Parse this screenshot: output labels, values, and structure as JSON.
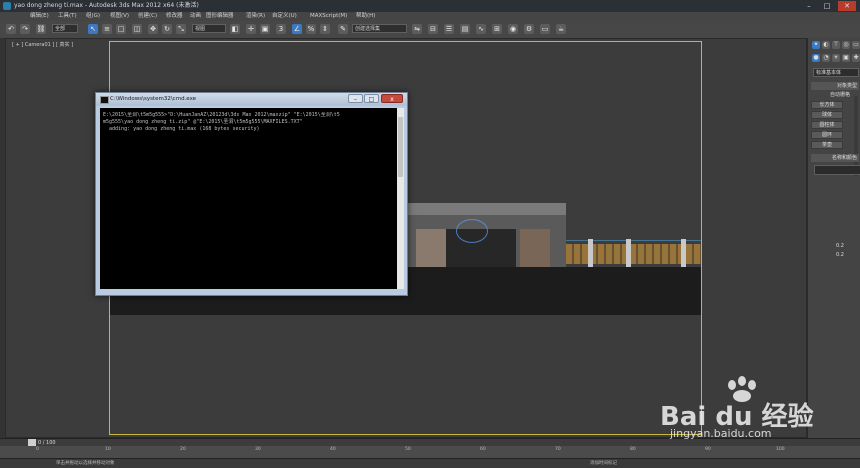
{
  "window": {
    "title": "yao dong zheng ti.max - Autodesk 3ds Max 2012 x64 (未激活)",
    "min": "–",
    "max": "□",
    "close": "✕"
  },
  "menu": [
    "编辑(E)",
    "工具(T)",
    "组(G)",
    "视图(V)",
    "创建(C)",
    "修改器",
    "动画",
    "图形编辑器",
    "渲染(R)",
    "自定义(U)",
    "MAXScript(M)",
    "帮助(H)"
  ],
  "toolbar": {
    "filter_select": "全部",
    "view_select": "视图",
    "named_sel": "创建选择集"
  },
  "viewport": {
    "label": "[ + ] Camera01 ] [ 真实 ]"
  },
  "cmd": {
    "title": "C:\\Windows\\system32\\cmd.exe",
    "lines": "E:\\2015\\圣洞\\t5m5g555>\"D:\\HuanJanAZ\\20123d\\3ds Max 2012\\maxzip\" \"E:\\2015\\圣洞\\t5\nm5g555\\yao dong zheng ti.zip\" @\"E:\\2015\\圣洞\\t5m5g555\\MAXFILES.TXT\"\n  adding: yao dong zheng ti.max (168 bytes security)",
    "min": "–",
    "max": "□",
    "close": "x"
  },
  "panel": {
    "dropdown": "标准基本体",
    "rollout_object": "对象类型",
    "autogrid": "自动栅格",
    "buttons": [
      "长方体",
      "球体",
      "圆柱体",
      "圆环",
      "茶壶"
    ],
    "rollout_name": "名称和颜色",
    "coord_x": "0.2",
    "coord_y": "0.2"
  },
  "timeline": {
    "frame": "0 / 100",
    "ticks": [
      "0",
      "10",
      "20",
      "30",
      "40",
      "50",
      "60",
      "70",
      "80",
      "90",
      "100"
    ]
  },
  "status": {
    "left": "单击并拖动以选择并移动对象",
    "right": "添加时间标记"
  },
  "watermark": {
    "brand": "Bai du 经验",
    "url": "jingyan.baidu.com"
  }
}
